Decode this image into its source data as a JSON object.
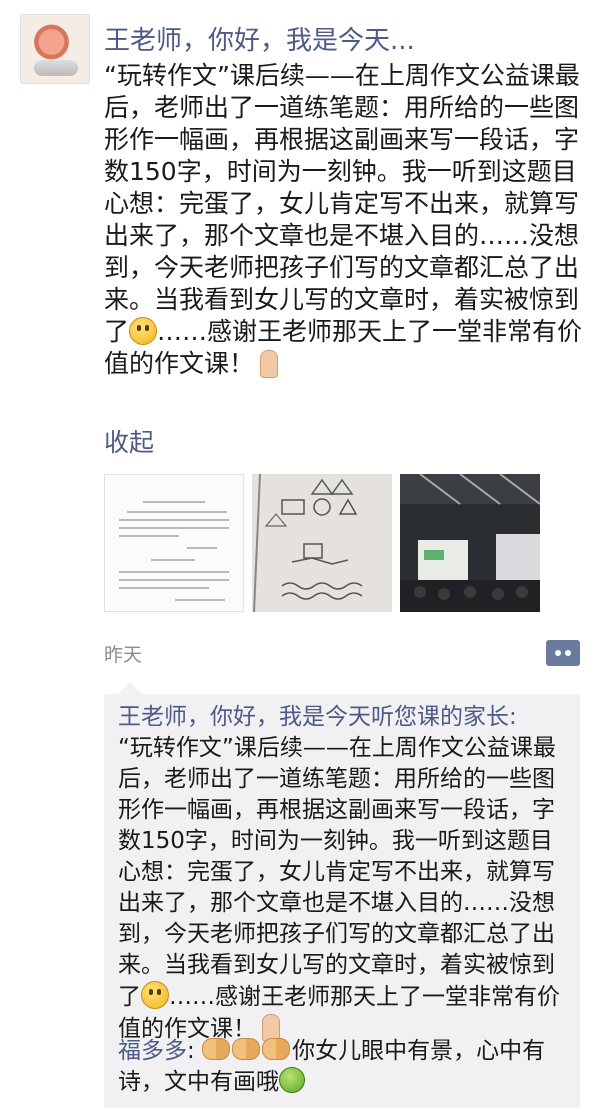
{
  "post": {
    "author": "王老师，你好，我是今天...",
    "text": "“玩转作文”课后续——在上周作文公益课最后，老师出了一道练笔题：用所给的一些图形作一幅画，再根据这副画来写一段话，字数150字，时间为一刻钟。我一听到这题目心想：完蛋了，女儿肯定写不出来，就算写出来了，那个文章也是不堪入目的……没想到，今天老师把孩子们写的文章都汇总了出来。当我看到女儿写的文章时，着实被惊到了",
    "text_tail": "……感谢王老师那天上了一堂非常有价值的作文课！",
    "collapse_label": "收起",
    "timestamp": "昨天",
    "photos": [
      "essay-page",
      "drawing-shapes",
      "classroom-lecture"
    ]
  },
  "comments": [
    {
      "author": "王老师，你好，我是今天听您课的家长:",
      "text": "“玩转作文”课后续——在上周作文公益课最后，老师出了一道练笔题：用所给的一些图形作一幅画，再根据这副画来写一段话，字数150字，时间为一刻钟。我一听到这题目心想：完蛋了，女儿肯定写不出来，就算写出来了，那个文章也是不堪入目的……没想到，今天老师把孩子们写的文章都汇总了出来。当我看到女儿写的文章时，着实被惊到了",
      "text_tail": "……感谢王老师那天上了一堂非常有价值的作文课！"
    },
    {
      "author": "福多多",
      "separator": ": ",
      "text": "你女儿眼中有景，心中有诗，文中有画哦"
    }
  ],
  "colors": {
    "link_blue": "#4e5a86",
    "comment_bg": "#f1f1f3",
    "time_gray": "#8c8c8c"
  },
  "icons": [
    "shocked-emoji",
    "pray-emoji",
    "handshake-emoji",
    "green-face-emoji",
    "more-dots-icon"
  ]
}
